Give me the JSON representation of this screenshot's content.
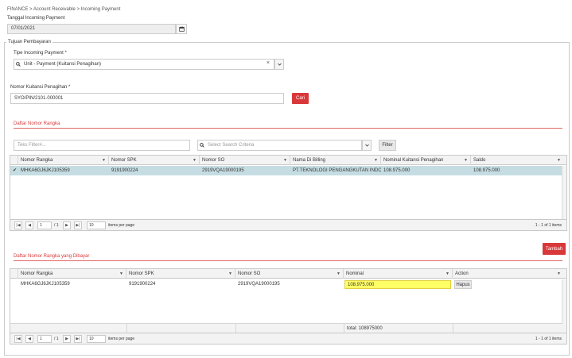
{
  "breadcrumb": "FINANCE > Account Receivable > Incoming Payment",
  "tanggal": {
    "label": "Tanggal Incoming Payment",
    "value": "07/01/2021"
  },
  "tujuan": {
    "legend": "Tujuan Pembayaran",
    "tipe_label": "Tipe Incoming Payment *",
    "tipe_value": "Unit - Payment (Kuitansi Penagihan)",
    "clear": "×",
    "nomor_label": "Nomor Kuitansi Penagihan *",
    "nomor_value": "SYO/PIN/2101-000001",
    "cari": "Cari"
  },
  "daftar": {
    "title": "Daftar Nomor Rangka",
    "filter_placeholder": "Teks Filter#...",
    "criteria_placeholder": "Select Search Criteria",
    "filter_button": "Filter",
    "headers": [
      "Nomor Rangka",
      "Nomor SPK",
      "Nomor SO",
      "Nama Di Billing",
      "Nominal Kuitansi Penagihan",
      "Saldo"
    ],
    "rows": [
      {
        "check": "✔",
        "rangka": "MHKA6GJ6JKJ105359",
        "spk": "9191900224",
        "so": "2919VQA19000195",
        "nama": "PT.TEKNOLOGI PENGANGKUTAN INDONESIA",
        "nominal": "108.975.000",
        "saldo": "108.975.000"
      }
    ],
    "pager": {
      "page": "1",
      "of": "/ 1",
      "size": "10",
      "per_page": "items per page",
      "info": "1 - 1 of 1 items"
    }
  },
  "tambah": "Tambah",
  "dibayar": {
    "title": "Daftar Nomor Rangka yang Dibayar",
    "headers": [
      "Nomor Rangka",
      "Nomor SPK",
      "Nomor SO",
      "Nominal",
      "Action"
    ],
    "rows": [
      {
        "rangka": "MHKA6GJ6JKJ105359",
        "spk": "9191900224",
        "so": "2919VQA19000195",
        "nominal": "108.975.000",
        "action": "Hapus"
      }
    ],
    "total": "total: 108975000",
    "pager": {
      "page": "1",
      "of": "/ 1",
      "size": "10",
      "per_page": "items per page",
      "info": "1 - 1 of 1 items"
    }
  },
  "colors": {
    "accent": "#d9383a",
    "selected_row": "#c5dde2",
    "highlight": "#ffff66"
  },
  "icons": [
    "calendar-icon",
    "search-icon",
    "chevron-down-icon",
    "check-icon",
    "first-page-icon",
    "prev-page-icon",
    "next-page-icon",
    "last-page-icon"
  ]
}
